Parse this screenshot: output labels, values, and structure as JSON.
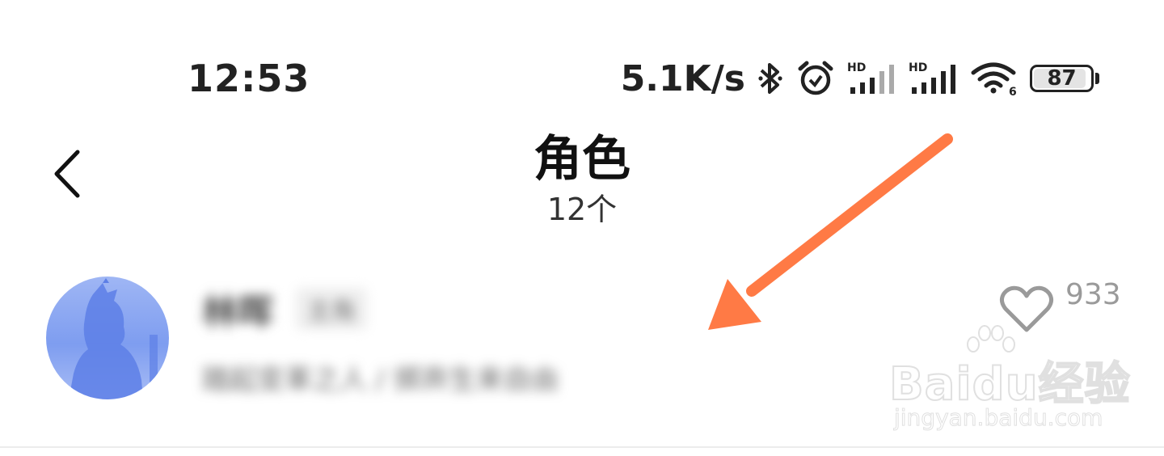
{
  "status_bar": {
    "time": "12:53",
    "net_speed": "5.1K/s",
    "battery_level": "87",
    "icons": [
      "bluetooth-icon",
      "alarm-icon",
      "signal-hd-icon",
      "signal-hd-icon",
      "wifi-6-icon",
      "battery-icon"
    ]
  },
  "header": {
    "title": "角色",
    "subtitle": "12个"
  },
  "character": {
    "name": "林晖",
    "tag": "主角",
    "description": "踏起变革之人 / 掷弃生来自由",
    "like_count": "933"
  },
  "watermark": {
    "brand": "Baidu经验",
    "url": "jingyan.baidu.com"
  },
  "colors": {
    "annotation_arrow": "#ff7a45",
    "avatar_bg": "#8aa6f2",
    "like_icon": "#9a9a9a"
  }
}
